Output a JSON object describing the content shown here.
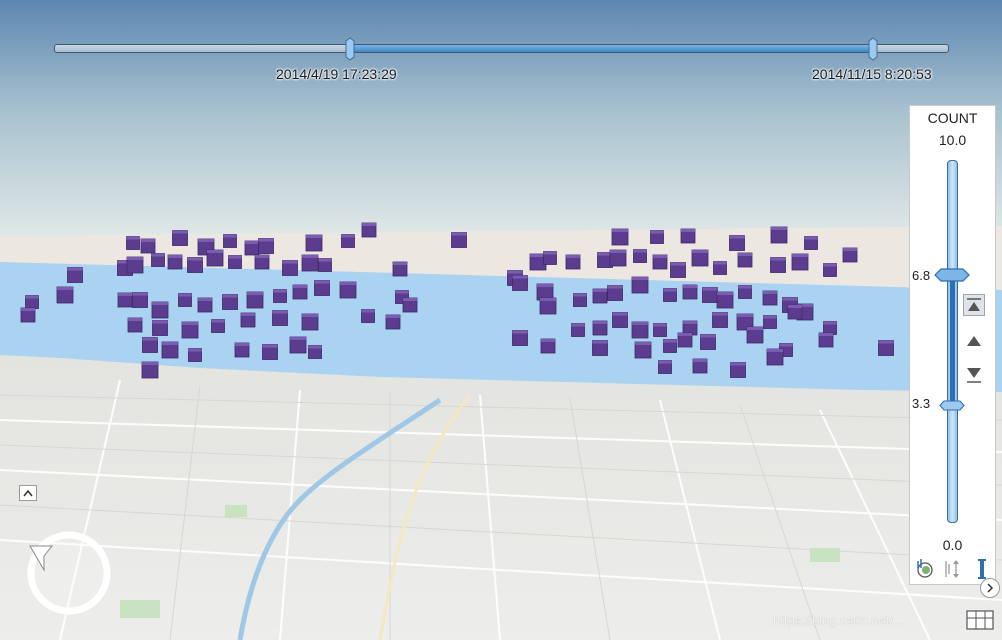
{
  "time_slider": {
    "start_label": "2014/4/19 17:23:29",
    "end_label": "2014/11/15 8:20:53"
  },
  "range_panel": {
    "field": "COUNT",
    "max": "10.0",
    "min": "0.0",
    "upper_value": "6.8",
    "lower_value": "3.3"
  },
  "colors": {
    "cube_fill": "#5b3c8f",
    "water": "#aad3f2",
    "accent": "#3f86c6"
  },
  "watermark": "https://blog.csdn.net/..."
}
